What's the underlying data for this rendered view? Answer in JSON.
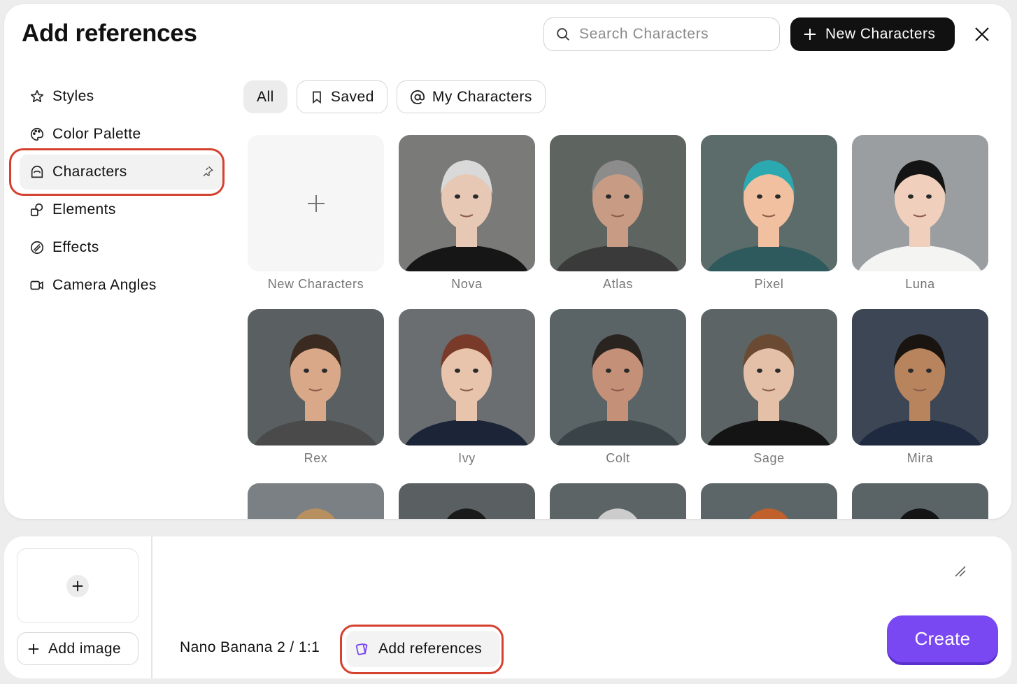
{
  "modal": {
    "title": "Add references",
    "search_placeholder": "Search Characters",
    "new_button_label": "New Characters"
  },
  "sidebar": {
    "items": [
      {
        "label": "Styles",
        "icon": "star-icon"
      },
      {
        "label": "Color Palette",
        "icon": "palette-icon"
      },
      {
        "label": "Characters",
        "icon": "character-icon",
        "active": true
      },
      {
        "label": "Elements",
        "icon": "shapes-icon"
      },
      {
        "label": "Effects",
        "icon": "effects-icon"
      },
      {
        "label": "Camera Angles",
        "icon": "camera-icon"
      }
    ]
  },
  "filters": [
    {
      "label": "All",
      "active": true
    },
    {
      "label": "Saved",
      "icon": "bookmark-icon"
    },
    {
      "label": "My Characters",
      "icon": "at-icon"
    }
  ],
  "characters": [
    {
      "name": "New Characters",
      "type": "add"
    },
    {
      "name": "Nova",
      "bg": "#7a7a78",
      "skin": "#e6c8b4",
      "hair": "#d9d9d9",
      "shirt": "#161616"
    },
    {
      "name": "Atlas",
      "bg": "#5e6460",
      "skin": "#c89c84",
      "hair": "#8c8c8c",
      "shirt": "#3a3a3a"
    },
    {
      "name": "Pixel",
      "bg": "#5c6c6a",
      "skin": "#f0c0a0",
      "hair": "#2ca8b0",
      "shirt": "#2e5a5e"
    },
    {
      "name": "Luna",
      "bg": "#9a9ea0",
      "skin": "#f0d0bc",
      "hair": "#141414",
      "shirt": "#f4f4f2"
    },
    {
      "name": "Rex",
      "bg": "#5a6062",
      "skin": "#d8a888",
      "hair": "#3a2a20",
      "shirt": "#4a4a4a"
    },
    {
      "name": "Ivy",
      "bg": "#6a6e70",
      "skin": "#e8c4ac",
      "hair": "#7a3a2a",
      "shirt": "#1c2438"
    },
    {
      "name": "Colt",
      "bg": "#5a6466",
      "skin": "#c49078",
      "hair": "#2a2420",
      "shirt": "#3a4448"
    },
    {
      "name": "Sage",
      "bg": "#5c6466",
      "skin": "#e4c0a8",
      "hair": "#6a4a32",
      "shirt": "#141414"
    },
    {
      "name": "Mira",
      "bg": "#3c4654",
      "skin": "#b8845e",
      "hair": "#1a1410",
      "shirt": "#1e2a40"
    },
    {
      "name": "",
      "bg": "#7a8084",
      "skin": "#e0b898",
      "hair": "#b89060",
      "shirt": "#444"
    },
    {
      "name": "",
      "bg": "#5a6062",
      "skin": "#5a3a28",
      "hair": "#1a1a1a",
      "shirt": "#333"
    },
    {
      "name": "",
      "bg": "#5c6466",
      "skin": "#e8ccb8",
      "hair": "#cccccc",
      "shirt": "#333"
    },
    {
      "name": "",
      "bg": "#5c6668",
      "skin": "#f0c8b0",
      "hair": "#c0602a",
      "shirt": "#333"
    },
    {
      "name": "",
      "bg": "#5a6466",
      "skin": "#d8b090",
      "hair": "#141414",
      "shirt": "#333"
    }
  ],
  "composer": {
    "add_image_label": "Add image",
    "model_label": "Nano Banana 2 / 1:1",
    "add_references_label": "Add references",
    "create_label": "Create"
  },
  "colors": {
    "accent": "#7a48f2",
    "highlight": "#d5412f"
  }
}
